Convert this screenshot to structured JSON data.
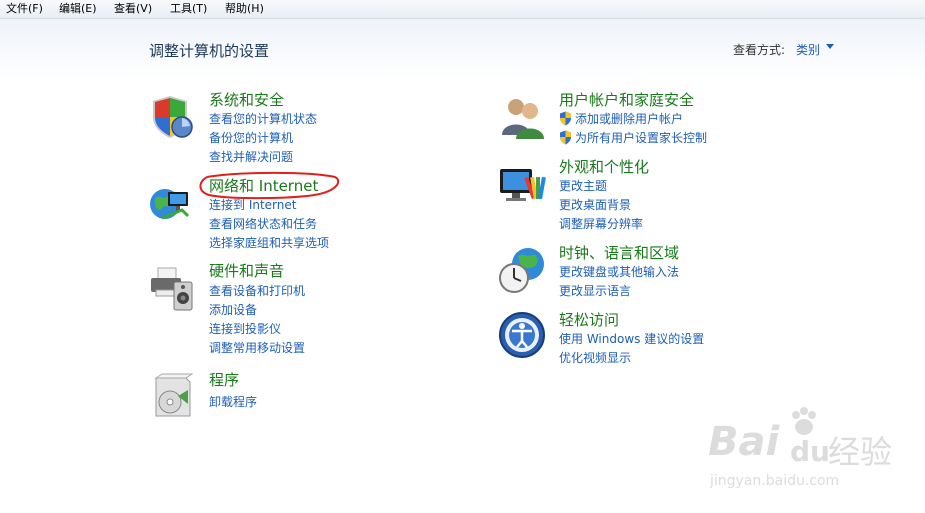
{
  "menubar": {
    "items": [
      "文件(F)",
      "编辑(E)",
      "查看(V)",
      "工具(T)",
      "帮助(H)"
    ]
  },
  "header": {
    "title": "调整计算机的设置",
    "view_by_label": "查看方式:",
    "view_by_value": "类别"
  },
  "categories": {
    "system_security": {
      "title": "系统和安全",
      "links": [
        "查看您的计算机状态",
        "备份您的计算机",
        "查找并解决问题"
      ]
    },
    "network_internet": {
      "title": "网络和 Internet",
      "links": [
        "连接到 Internet",
        "查看网络状态和任务",
        "选择家庭组和共享选项"
      ]
    },
    "hardware_sound": {
      "title": "硬件和声音",
      "links": [
        "查看设备和打印机",
        "添加设备",
        "连接到投影仪",
        "调整常用移动设置"
      ]
    },
    "programs": {
      "title": "程序",
      "links": [
        "卸载程序"
      ]
    },
    "user_accounts": {
      "title": "用户帐户和家庭安全",
      "links": [
        "添加或删除用户帐户",
        "为所有用户设置家长控制"
      ]
    },
    "appearance": {
      "title": "外观和个性化",
      "links": [
        "更改主题",
        "更改桌面背景",
        "调整屏幕分辨率"
      ]
    },
    "clock_language": {
      "title": "时钟、语言和区域",
      "links": [
        "更改键盘或其他输入法",
        "更改显示语言"
      ]
    },
    "ease_of_access": {
      "title": "轻松访问",
      "links": [
        "使用 Windows 建议的设置",
        "优化视频显示"
      ]
    }
  },
  "watermark": {
    "brand_latin": "Bai",
    "brand_du": "du",
    "brand_cn": "经验",
    "url": "jingyan.baidu.com"
  },
  "colors": {
    "category_title": "#1a7a1a",
    "link": "#1e5fb5",
    "page_title": "#1e395b",
    "annotation": "#e0201b"
  }
}
